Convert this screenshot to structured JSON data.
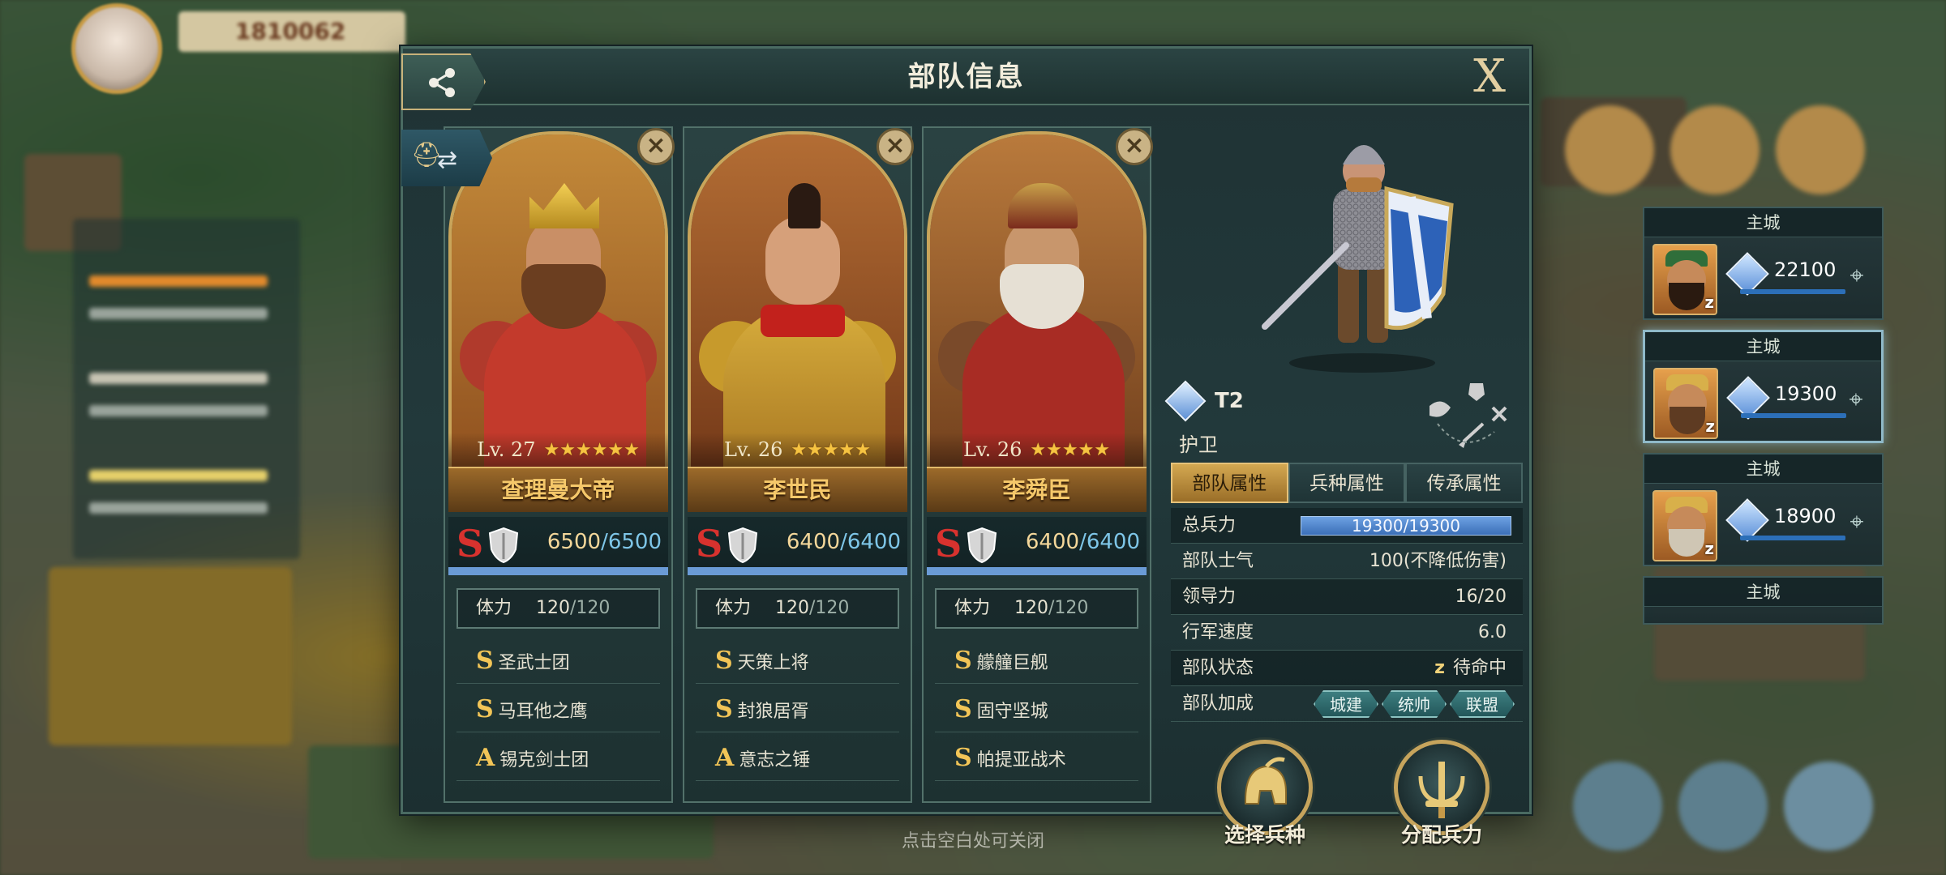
{
  "background": {
    "player_resource": "1810062",
    "close_hint": "点击空白处可关闭"
  },
  "dialog": {
    "title": "部队信息",
    "close_label": "X"
  },
  "commanders": [
    {
      "level": "Lv. 27",
      "stars": "★★★★★★",
      "name": "查理曼大帝",
      "rank": "S",
      "troops_current": "6500",
      "troops_max": "/6500",
      "stamina_label": "体力",
      "stamina_current": "120",
      "stamina_max": "/120",
      "skills": [
        {
          "grade": "S",
          "name": "圣武士团"
        },
        {
          "grade": "S",
          "name": "马耳他之鹰"
        },
        {
          "grade": "A",
          "name": "锡克剑士团"
        }
      ]
    },
    {
      "level": "Lv. 26",
      "stars": "★★★★★",
      "name": "李世民",
      "rank": "S",
      "troops_current": "6400",
      "troops_max": "/6400",
      "stamina_label": "体力",
      "stamina_current": "120",
      "stamina_max": "/120",
      "skills": [
        {
          "grade": "S",
          "name": "天策上将"
        },
        {
          "grade": "S",
          "name": "封狼居胥"
        },
        {
          "grade": "A",
          "name": "意志之锤"
        }
      ]
    },
    {
      "level": "Lv. 26",
      "stars": "★★★★★",
      "name": "李舜臣",
      "rank": "S",
      "troops_current": "6400",
      "troops_max": "/6400",
      "stamina_label": "体力",
      "stamina_current": "120",
      "stamina_max": "/120",
      "skills": [
        {
          "grade": "S",
          "name": "艨艟巨舰"
        },
        {
          "grade": "S",
          "name": "固守坚城"
        },
        {
          "grade": "S",
          "name": "帕提亚战术"
        }
      ]
    }
  ],
  "unit": {
    "tier": "T2",
    "name": "护卫"
  },
  "tabs": [
    "部队属性",
    "兵种属性",
    "传承属性"
  ],
  "attributes": {
    "total_troops_label": "总兵力",
    "total_troops_value": "19300/19300",
    "total_troops_fill": 1.0,
    "morale_label": "部队士气",
    "morale_value": "100(不降低伤害)",
    "leadership_label": "领导力",
    "leadership_value": "16/20",
    "speed_label": "行军速度",
    "speed_value": "6.0",
    "status_label": "部队状态",
    "status_value": "待命中",
    "boost_label": "部队加成",
    "boost_tags": [
      "城建",
      "统帅",
      "联盟"
    ]
  },
  "actions": {
    "select_unit": "选择兵种",
    "assign_troops": "分配兵力"
  },
  "troop_list": [
    {
      "location": "主城",
      "value": "22100"
    },
    {
      "location": "主城",
      "value": "19300"
    },
    {
      "location": "主城",
      "value": "18900"
    },
    {
      "location": "主城"
    }
  ],
  "colors": {
    "accent_gold": "#c9a55a",
    "rank_red": "#d8322e",
    "troop_bar_blue": "#6a9bd6",
    "panel_bg": "#1f3234"
  }
}
